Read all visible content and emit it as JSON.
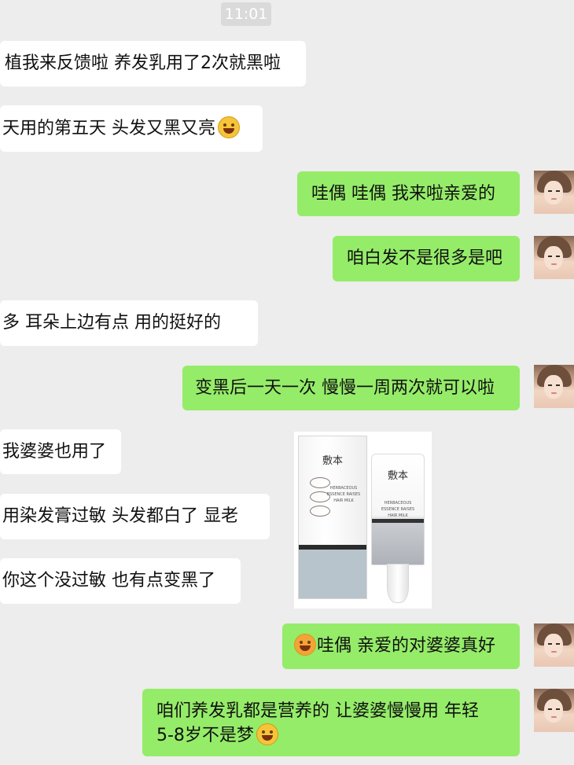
{
  "timestamp": "11:01",
  "messages": [
    {
      "side": "left",
      "text": "植我来反馈啦  养发乳用了2次就黑啦"
    },
    {
      "side": "left",
      "text": "天用的第五天 头发又黑又亮",
      "emoji_after": "grinning-face-emoji"
    },
    {
      "side": "right",
      "text": "哇偶 哇偶  我来啦亲爱的"
    },
    {
      "side": "right",
      "text": "咱白发不是很多是吧"
    },
    {
      "side": "left",
      "text": "多  耳朵上边有点   用的挺好的"
    },
    {
      "side": "right",
      "text": "变黑后一天一次 慢慢一周两次就可以啦"
    },
    {
      "side": "left",
      "text": "我婆婆也用了"
    },
    {
      "side": "left",
      "text": "用染发膏过敏  头发都白了  显老"
    },
    {
      "side": "left",
      "text": "你这个没过敏  也有点变黑了"
    },
    {
      "side": "right",
      "text": "哇偶 亲爱的对婆婆真好",
      "emoji_before": "hugging-face-emoji"
    },
    {
      "side": "right",
      "line1": "咱们养发乳都是营养的    让婆婆慢慢用   年轻",
      "line2": "5-8岁不是梦",
      "emoji_after": "thinking-face-emoji"
    }
  ],
  "product": {
    "brand": "敷本",
    "box_text": "HERBACEOUS ESSENCE RAISES HAIR MILK",
    "band_text": "HERBAL ESSENCE",
    "tube_text": "HERBACEOUS ESSENCE RAISES HAIR MILK"
  },
  "colors": {
    "background": "#ededed",
    "sent_bubble": "#95ec69",
    "received_bubble": "#ffffff"
  }
}
